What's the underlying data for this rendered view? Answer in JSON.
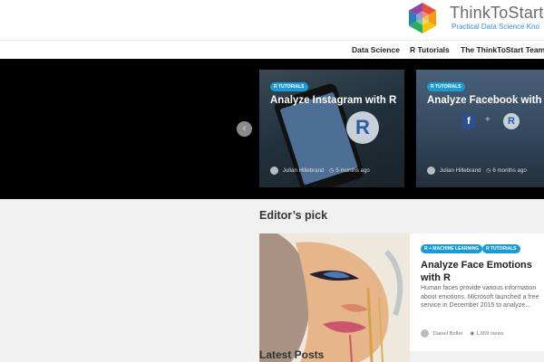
{
  "logo": {
    "title": "ThinkToStart",
    "tagline": "Practical Data Science Kno"
  },
  "nav": {
    "items": [
      "Data Science",
      "R Tutorials",
      "The ThinkToStart Team"
    ]
  },
  "slider": {
    "cards": [
      {
        "tag": "R TUTORIALS",
        "title": "Analyze Instagram with R",
        "author": "Julian Hillebrand",
        "time": "5 months ago"
      },
      {
        "tag": "R TUTORIALS",
        "title": "Analyze Facebook with R",
        "author": "Julian Hillebrand",
        "time": "6 months ago"
      }
    ]
  },
  "editors_pick": {
    "heading": "Editor’s pick",
    "tags": [
      "R + MACHINE LEARNING",
      "R TUTORIALS"
    ],
    "title": "Analyze Face Emotions with R",
    "excerpt": "Human faces provide various information about emotions. Microsoft launched a free service in December 2015 to analyze…",
    "author": "Daniel Boller",
    "views": "1,959 views"
  },
  "latest": {
    "heading": "Latest Posts"
  },
  "colors": {
    "accent": "#1a9bd8",
    "slider_bg": "#000000",
    "page_bg": "#f1f1f1"
  }
}
